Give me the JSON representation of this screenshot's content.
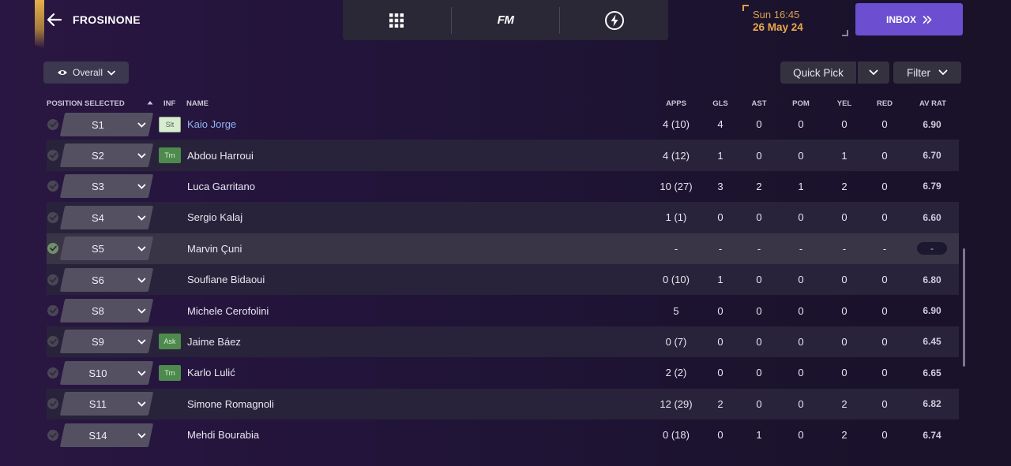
{
  "header": {
    "club_name": "FROSINONE",
    "time": "Sun 16:45",
    "date": "26 May 24",
    "inbox_label": "INBOX",
    "nav_logo": "FM"
  },
  "toolbar": {
    "view_label": "Overall",
    "quick_pick_label": "Quick Pick",
    "filter_label": "Filter"
  },
  "columns": {
    "position_selected": "POSITION SELECTED",
    "inf": "INF",
    "name": "NAME",
    "apps": "APPS",
    "gls": "GLS",
    "ast": "AST",
    "pom": "POM",
    "yel": "YEL",
    "red": "RED",
    "av_rat": "AV RAT"
  },
  "rows": [
    {
      "pos": "S1",
      "inf": "Slt",
      "inf_type": "slt",
      "name": "Kaio Jorge",
      "link": true,
      "apps": "4 (10)",
      "gls": "4",
      "ast": "0",
      "pom": "0",
      "yel": "0",
      "red": "0",
      "avrat": "6.90",
      "checked": false
    },
    {
      "pos": "S2",
      "inf": "Trn",
      "inf_type": "trn",
      "name": "Abdou Harroui",
      "link": false,
      "apps": "4 (12)",
      "gls": "1",
      "ast": "0",
      "pom": "0",
      "yel": "1",
      "red": "0",
      "avrat": "6.70",
      "checked": false
    },
    {
      "pos": "S3",
      "inf": "",
      "inf_type": "",
      "name": "Luca Garritano",
      "link": false,
      "apps": "10 (27)",
      "gls": "3",
      "ast": "2",
      "pom": "1",
      "yel": "2",
      "red": "0",
      "avrat": "6.79",
      "checked": false
    },
    {
      "pos": "S4",
      "inf": "",
      "inf_type": "",
      "name": "Sergio Kalaj",
      "link": false,
      "apps": "1 (1)",
      "gls": "0",
      "ast": "0",
      "pom": "0",
      "yel": "0",
      "red": "0",
      "avrat": "6.60",
      "checked": false
    },
    {
      "pos": "S5",
      "inf": "",
      "inf_type": "",
      "name": "Marvin Çuni",
      "link": false,
      "apps": "-",
      "gls": "-",
      "ast": "-",
      "pom": "-",
      "yel": "-",
      "red": "-",
      "avrat": "-",
      "checked": true
    },
    {
      "pos": "S6",
      "inf": "",
      "inf_type": "",
      "name": "Soufiane Bidaoui",
      "link": false,
      "apps": "0 (10)",
      "gls": "1",
      "ast": "0",
      "pom": "0",
      "yel": "0",
      "red": "0",
      "avrat": "6.80",
      "checked": false
    },
    {
      "pos": "S8",
      "inf": "",
      "inf_type": "",
      "name": "Michele Cerofolini",
      "link": false,
      "apps": "5",
      "gls": "0",
      "ast": "0",
      "pom": "0",
      "yel": "0",
      "red": "0",
      "avrat": "6.90",
      "checked": false
    },
    {
      "pos": "S9",
      "inf": "Ask",
      "inf_type": "ask",
      "name": "Jaime Báez",
      "link": false,
      "apps": "0 (7)",
      "gls": "0",
      "ast": "0",
      "pom": "0",
      "yel": "0",
      "red": "0",
      "avrat": "6.45",
      "checked": false
    },
    {
      "pos": "S10",
      "inf": "Trn",
      "inf_type": "trn",
      "name": "Karlo Lulić",
      "link": false,
      "apps": "2 (2)",
      "gls": "0",
      "ast": "0",
      "pom": "0",
      "yel": "0",
      "red": "0",
      "avrat": "6.65",
      "checked": false
    },
    {
      "pos": "S11",
      "inf": "",
      "inf_type": "",
      "name": "Simone Romagnoli",
      "link": false,
      "apps": "12 (29)",
      "gls": "2",
      "ast": "0",
      "pom": "0",
      "yel": "2",
      "red": "0",
      "avrat": "6.82",
      "checked": false
    },
    {
      "pos": "S14",
      "inf": "",
      "inf_type": "",
      "name": "Mehdi Bourabia",
      "link": false,
      "apps": "0 (18)",
      "gls": "0",
      "ast": "1",
      "pom": "0",
      "yel": "2",
      "red": "0",
      "avrat": "6.74",
      "checked": false
    }
  ],
  "colors": {
    "accent": "#6b4fd0",
    "date": "#e8a94b",
    "link": "#8fb4ee"
  }
}
